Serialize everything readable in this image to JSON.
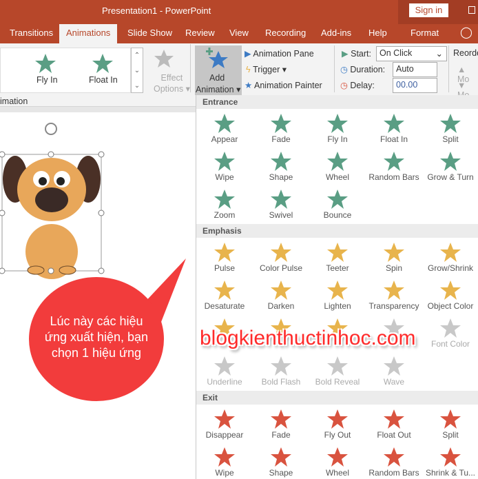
{
  "title": "Presentation1  -  PowerPoint",
  "sign_in": "Sign in",
  "tabs": [
    "Transitions",
    "Animations",
    "Slide Show",
    "Review",
    "View",
    "Recording",
    "Add-ins",
    "Help",
    "Format"
  ],
  "ribbon": {
    "gallery": [
      "Fly In",
      "Float In"
    ],
    "effect_options": [
      "Effect",
      "Options"
    ],
    "add_animation": [
      "Add",
      "Animation"
    ],
    "animation_pane": "Animation Pane",
    "trigger": "Trigger",
    "animation_painter": "Animation Painter",
    "start_label": "Start:",
    "start_value": "On Click",
    "duration_label": "Duration:",
    "duration_value": "Auto",
    "delay_label": "Delay:",
    "delay_value": "00.00",
    "reorder": "Reorde",
    "move_earlier": "Mo",
    "move_later": "Mo",
    "group_label": "imation"
  },
  "colors": {
    "accent": "#b7472a",
    "entrance": "#5a9e84",
    "emphasis": "#e8b44c",
    "exit": "#d9533f",
    "disabled": "#c8c8c8"
  },
  "panel": {
    "entrance": {
      "title": "Entrance",
      "items": [
        "Appear",
        "Fade",
        "Fly In",
        "Float In",
        "Split",
        "Wipe",
        "Shape",
        "Wheel",
        "Random Bars",
        "Grow & Turn",
        "Zoom",
        "Swivel",
        "Bounce"
      ]
    },
    "emphasis": {
      "title": "Emphasis",
      "items": [
        "Pulse",
        "Color Pulse",
        "Teeter",
        "Spin",
        "Grow/Shrink",
        "Desaturate",
        "Darken",
        "Lighten",
        "Transparency",
        "Object Color",
        "",
        "",
        "",
        "",
        "Font Color",
        "Underline",
        "Bold Flash",
        "Bold Reveal",
        "Wave"
      ],
      "disabled_from": 13
    },
    "exit": {
      "title": "Exit",
      "items": [
        "Disappear",
        "Fade",
        "Fly Out",
        "Float Out",
        "Split",
        "Wipe",
        "Shape",
        "Wheel",
        "Random Bars",
        "Shrink & Tu..."
      ]
    }
  },
  "callout": "Lúc này các hiệu ứng xuất hiện, bạn chọn 1 hiệu ứng",
  "watermark": "blogkienthuctinhoc.com"
}
